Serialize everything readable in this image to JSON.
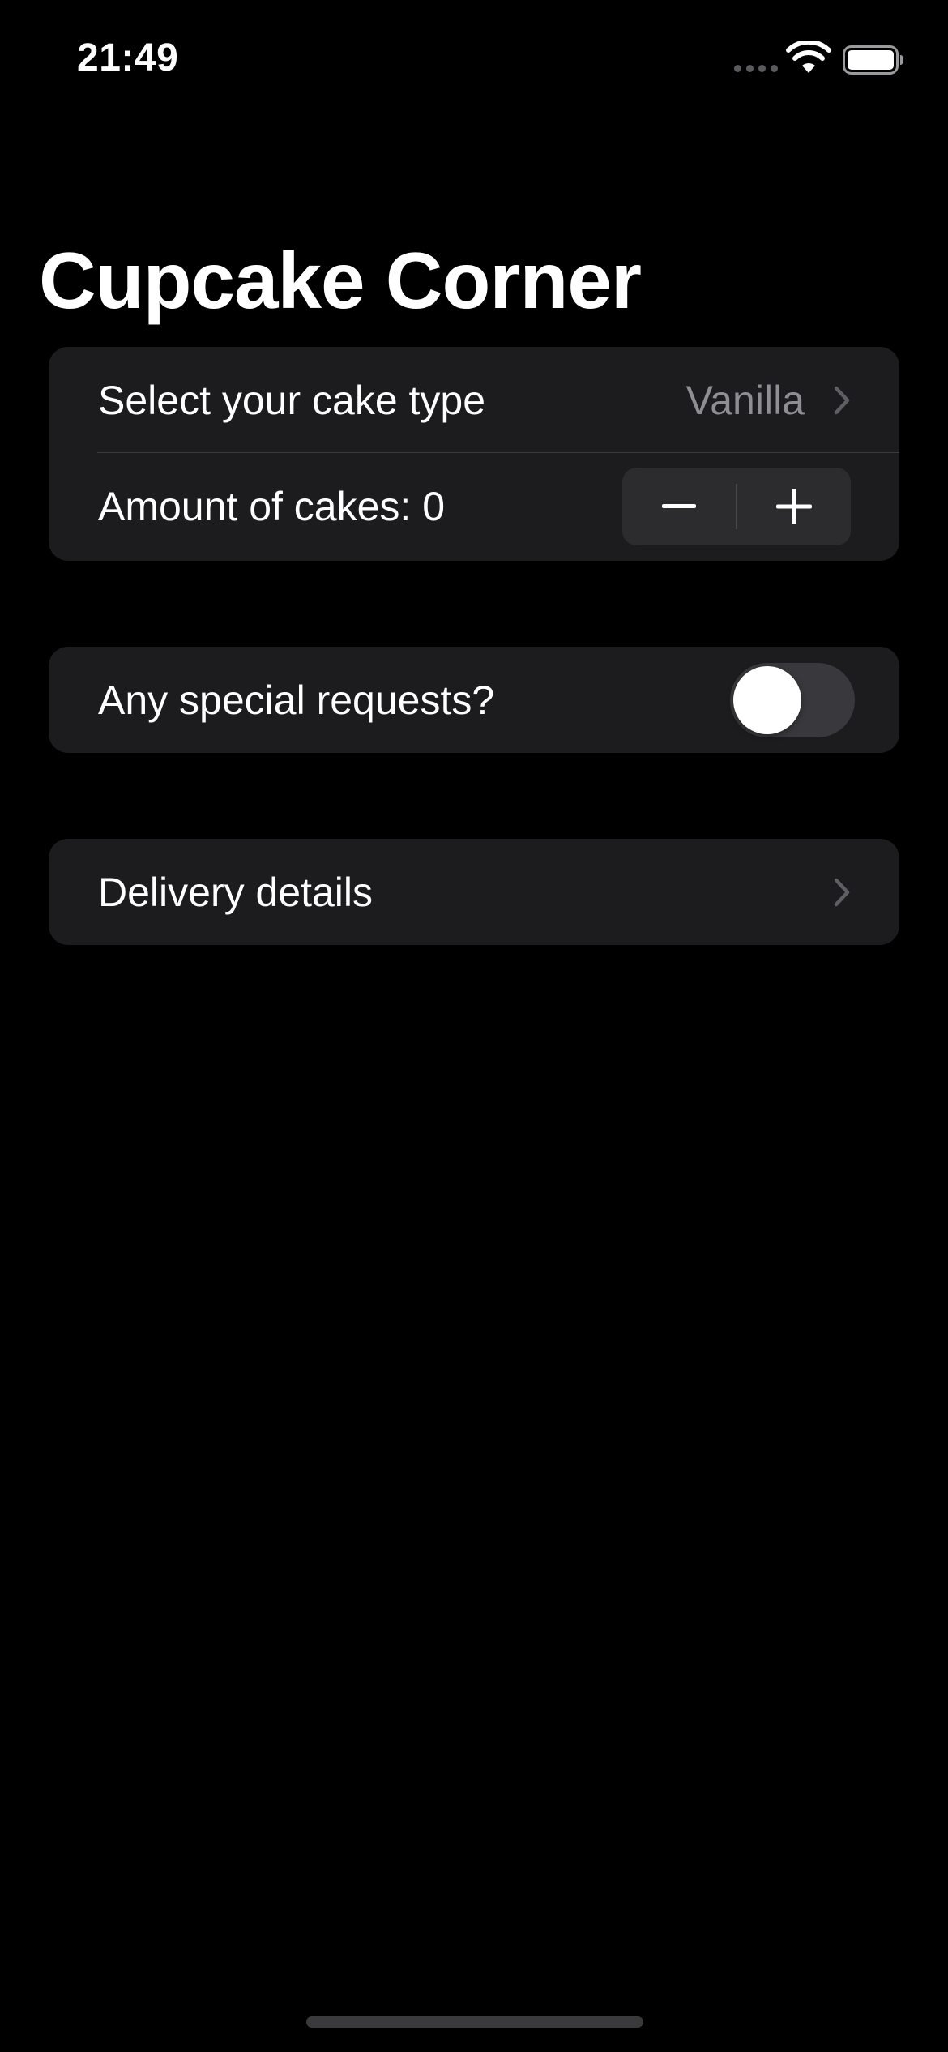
{
  "status_bar": {
    "time": "21:49",
    "icons": [
      "cellular-signal-icon",
      "wifi-icon",
      "battery-icon"
    ]
  },
  "title": "Cupcake Corner",
  "sections": {
    "order": {
      "cake_type_label": "Select your cake type",
      "cake_type_value": "Vanilla",
      "amount_label": "Amount of cakes: 0",
      "stepper_icons": [
        "minus-icon",
        "plus-icon"
      ]
    },
    "special": {
      "label": "Any special requests?",
      "toggle_on": false
    },
    "delivery": {
      "label": "Delivery details"
    }
  },
  "colors": {
    "background": "#000000",
    "cell": "#1c1c1e",
    "secondary_text": "#8e8e93",
    "toggle_off": "#39393d"
  }
}
